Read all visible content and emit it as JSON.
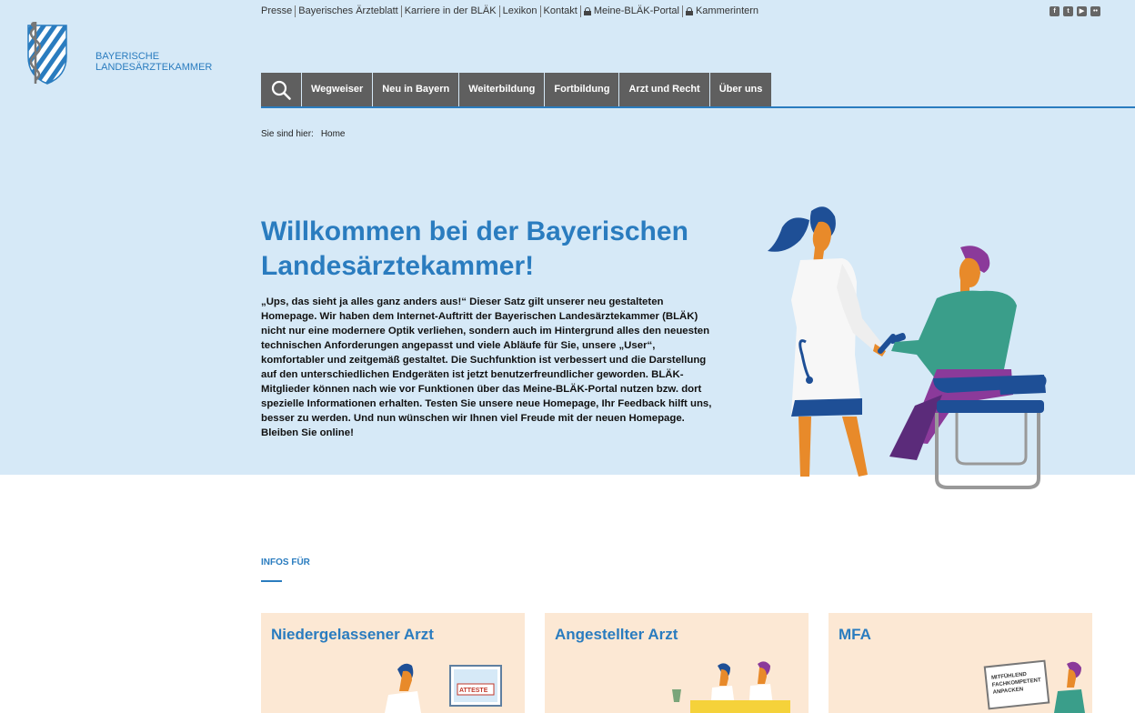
{
  "topnav": {
    "items": [
      "Presse",
      "Bayerisches Ärzteblatt",
      "Karriere in der BLÄK",
      "Lexikon",
      "Kontakt",
      "Meine-BLÄK-Portal",
      "Kammerintern"
    ]
  },
  "social": {
    "icons": [
      "facebook-icon",
      "twitter-icon",
      "youtube-icon",
      "flickr-icon"
    ],
    "glyphs": [
      "f",
      "t",
      "▶",
      "••"
    ]
  },
  "logo": {
    "line1": "BAYERISCHE",
    "line2": "LANDESÄRZTEKAMMER"
  },
  "mainnav": {
    "items": [
      "Wegweiser",
      "Neu in Bayern",
      "Weiterbildung",
      "Fortbildung",
      "Arzt und Recht",
      "Über uns"
    ]
  },
  "breadcrumb": {
    "label": "Sie sind hier:",
    "current": "Home"
  },
  "hero": {
    "title": "Willkommen bei der Bayerischen Landesärztekammer!",
    "text": "„Ups, das sieht ja alles ganz anders aus!“ Dieser Satz gilt unserer neu gestalteten Homepage. Wir haben dem Internet-Auftritt der Bayerischen Landesärztekammer (BLÄK) nicht nur eine modernere Optik verliehen, sondern auch im Hintergrund alles den neuesten technischen Anforderungen angepasst und viele Abläufe für Sie, unsere „User“, komfortabler und zeitgemäß gestaltet. Die Suchfunktion ist verbessert und die Darstellung auf den unterschiedlichen Endgeräten ist jetzt benutzerfreundlicher geworden. BLÄK-Mitglieder können nach wie vor Funktionen über das Meine-BLÄK-Portal nutzen bzw. dort spezielle Informationen erhalten. Testen Sie unsere neue Homepage, Ihr Feedback hilft uns, besser zu werden. Und nun wünschen wir Ihnen viel Freude mit der neuen Homepage.",
    "closing": "Bleiben Sie online!"
  },
  "infos": {
    "heading": "INFOS FÜR",
    "cards": [
      {
        "title": "Niedergelassener Arzt",
        "sign": "ATTESTE"
      },
      {
        "title": "Angestellter Arzt"
      },
      {
        "title": "MFA",
        "board": [
          "MITFÜHLEND",
          "FACHKOMPETENT",
          "ANPACKEN"
        ]
      }
    ]
  },
  "colors": {
    "accent": "#2a7cbf",
    "hero_bg": "#d6e9f7",
    "nav_bg": "#5f5f5f",
    "card_bg": "#fce8d4"
  }
}
